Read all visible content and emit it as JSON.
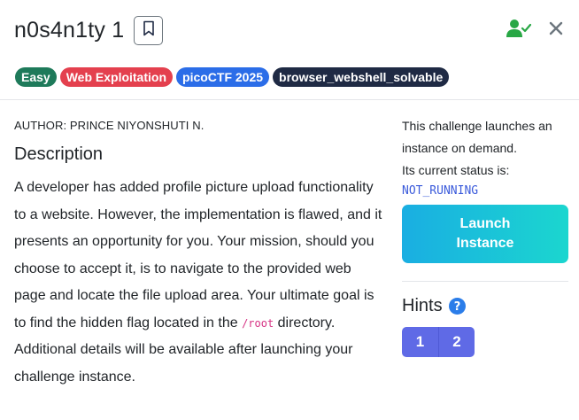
{
  "header": {
    "title": "n0s4n1ty 1"
  },
  "badges": [
    {
      "label": "Easy",
      "color": "#1e7a5a"
    },
    {
      "label": "Web Exploitation",
      "color": "#e4404e"
    },
    {
      "label": "picoCTF 2025",
      "color": "#2b6de8"
    },
    {
      "label": "browser_webshell_solvable",
      "color": "#1f2a44"
    }
  ],
  "main": {
    "author": "AUTHOR: PRINCE NIYONSHUTI N.",
    "description_heading": "Description",
    "description_before": "A developer has added profile picture upload functionality to a website. However, the implementation is flawed, and it presents an opportunity for you. Your mission, should you choose to accept it, is to navigate to the provided web page and locate the file upload area. Your ultimate goal is to find the hidden flag located in the ",
    "description_code": "/root",
    "description_after": " directory. Additional details will be available after launching your challenge instance."
  },
  "side": {
    "instance_text": "This challenge launches an instance on demand.",
    "status_label": "Its current status is:",
    "status_value": "NOT_RUNNING",
    "launch_button": "Launch Instance",
    "hints_title": "Hints",
    "hints": [
      "1",
      "2"
    ]
  },
  "icons": {
    "bookmark": "bookmark-icon",
    "user_check": "user-check-icon",
    "close": "close-icon",
    "help": "question-circle-icon"
  },
  "colors": {
    "accent_green": "#28a745",
    "status_blue": "#3b5bdb",
    "hint_purple": "#5f6ae6",
    "code_pink": "#d63384"
  }
}
